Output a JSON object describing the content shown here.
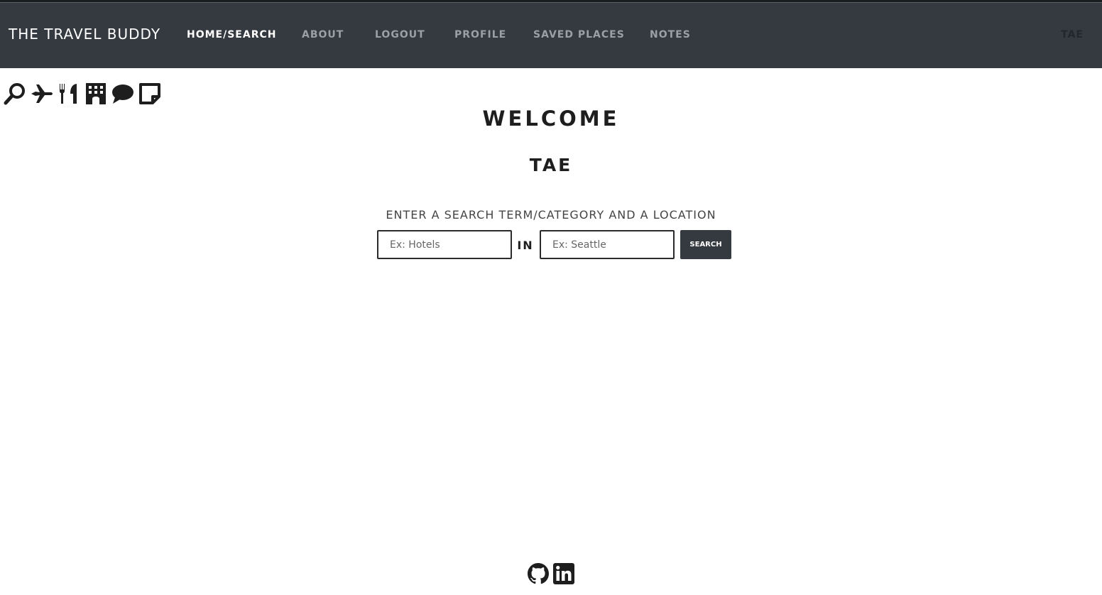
{
  "nav": {
    "brand": "THE TRAVEL BUDDY",
    "links": [
      "HOME/SEARCH",
      "ABOUT",
      "LOGOUT",
      "PROFILE",
      "SAVED PLACES",
      "NOTES"
    ],
    "user": "TAE"
  },
  "icons": [
    "search-icon",
    "plane-icon",
    "utensils-icon",
    "hotel-icon",
    "comment-icon",
    "note-icon"
  ],
  "welcome": "WELCOME",
  "username": "TAE",
  "prompt": "ENTER A SEARCH TERM/CATEGORY AND A LOCATION",
  "search": {
    "term_placeholder": "Ex: Hotels",
    "in_label": "IN",
    "location_placeholder": "Ex: Seattle",
    "button": "SEARCH"
  },
  "footer": [
    "github-icon",
    "linkedin-icon"
  ],
  "colors": {
    "navbar": "#343a40",
    "button": "#343a40",
    "text": "#1e1e1e"
  }
}
